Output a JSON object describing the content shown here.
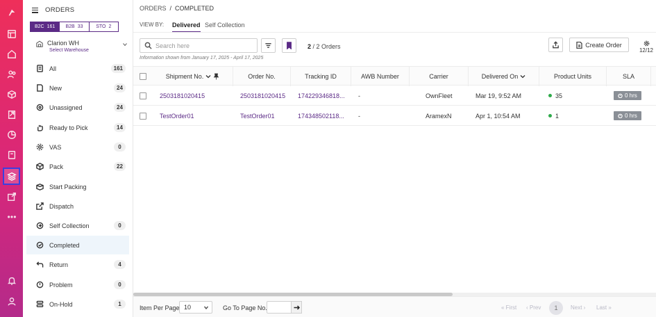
{
  "rail": {
    "items": [
      "logo-icon",
      "dashboard-icon",
      "home-icon",
      "users-icon",
      "box-icon",
      "receipt-icon",
      "chart-pie-icon",
      "clipboard-icon",
      "layers-icon",
      "external-link-icon",
      "more-icon",
      "bell-icon",
      "user-icon"
    ],
    "active": "layers-icon",
    "colors": {
      "top": "#ee2f5a",
      "bottom": "#b42a8a",
      "active_border": "#3b3fe0"
    }
  },
  "sidebar": {
    "title": "ORDERS",
    "segments": [
      {
        "label": "B2C",
        "count": "161"
      },
      {
        "label": "B2B",
        "count": "33"
      },
      {
        "label": "STO",
        "count": "2"
      }
    ],
    "warehouse": {
      "name": "Clarion WH",
      "sub": "Select Warehouse"
    },
    "items": [
      {
        "label": "All",
        "badge": "161",
        "icon": "list-icon"
      },
      {
        "label": "New",
        "badge": "24",
        "icon": "file-icon"
      },
      {
        "label": "Unassigned",
        "badge": "24",
        "icon": "target-icon"
      },
      {
        "label": "Ready to Pick",
        "badge": "14",
        "icon": "hand-icon"
      },
      {
        "label": "VAS",
        "badge": "0",
        "icon": "gear-icon"
      },
      {
        "label": "Pack",
        "badge": "22",
        "icon": "package-icon"
      },
      {
        "label": "Start Packing",
        "badge": "",
        "icon": "box-open-icon"
      },
      {
        "label": "Dispatch",
        "badge": "",
        "icon": "export-icon"
      },
      {
        "label": "Self Collection",
        "badge": "0",
        "icon": "collect-icon"
      },
      {
        "label": "Completed",
        "badge": "",
        "icon": "check-circle-icon"
      },
      {
        "label": "Return",
        "badge": "4",
        "icon": "return-icon"
      },
      {
        "label": "Problem",
        "badge": "0",
        "icon": "alert-icon"
      },
      {
        "label": "On-Hold",
        "badge": "1",
        "icon": "stack-icon"
      }
    ]
  },
  "breadcrumb": {
    "parent": "ORDERS",
    "sep": "/",
    "current": "COMPLETED"
  },
  "view": {
    "label": "VIEW BY:",
    "tabs": [
      "Delivered",
      "Self Collection"
    ]
  },
  "toolbar": {
    "search_placeholder": "Search here",
    "count_shown": "2",
    "count_total": "/ 2 Orders",
    "info": "Information shown from January 17, 2025 - April 17, 2025",
    "create_label": "Create Order",
    "columns_indicator": "12/12"
  },
  "table": {
    "headers": [
      "Shipment No.",
      "Order No.",
      "Tracking ID",
      "AWB Number",
      "Carrier",
      "Delivered On",
      "Product Units",
      "SLA"
    ],
    "rows": [
      {
        "shipment": "2503181020415",
        "order": "2503181020415",
        "tracking": "174229346818...",
        "awb": "-",
        "carrier": "OwnFleet",
        "delivered": "Mar 19, 9:52 AM",
        "units": "35",
        "sla": "0 hrs"
      },
      {
        "shipment": "TestOrder01",
        "order": "TestOrder01",
        "tracking": "174348502118...",
        "awb": "-",
        "carrier": "AramexN",
        "delivered": "Apr 1, 10:54 AM",
        "units": "1",
        "sla": "0 hrs"
      }
    ]
  },
  "footer": {
    "per_page_label": "Item Per Page",
    "per_page_value": "10",
    "goto_label": "Go To Page No.",
    "first": "« First",
    "prev": "‹ Prev",
    "page": "1",
    "next": "Next ›",
    "last": "Last »"
  }
}
